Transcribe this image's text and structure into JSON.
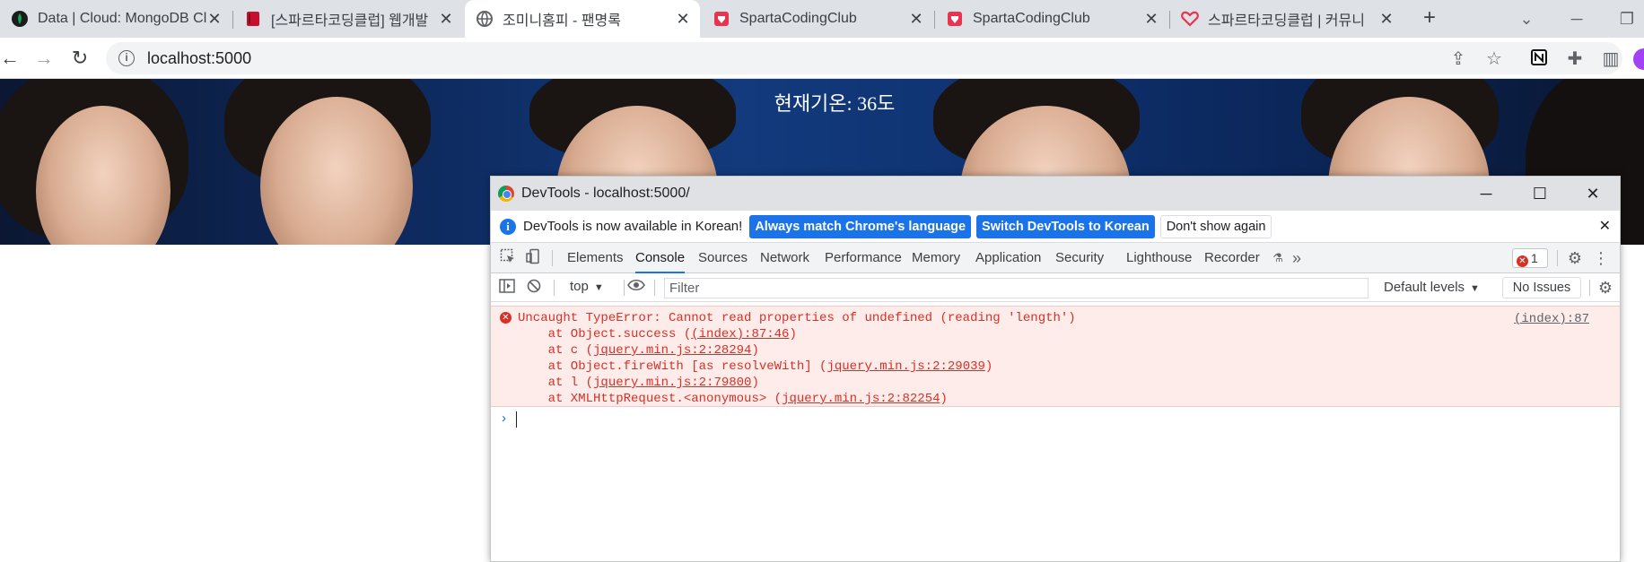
{
  "tabs": [
    {
      "title": "Data | Cloud: MongoDB Cl",
      "icon": "mongodb-leaf-icon"
    },
    {
      "title": "[스파르타코딩클럽] 웹개발",
      "icon": "book-icon"
    },
    {
      "title": "조미니홈피 - 팬명록",
      "icon": "globe-icon",
      "active": true
    },
    {
      "title": "SpartaCodingClub",
      "icon": "sparta-icon"
    },
    {
      "title": "SpartaCodingClub",
      "icon": "sparta-icon"
    },
    {
      "title": "스파르타코딩클럽 | 커뮤니",
      "icon": "heart-icon"
    }
  ],
  "tab_close": "✕",
  "newtab": "+",
  "address": {
    "url": "localhost:5000"
  },
  "page": {
    "weather": "현재기온: 36도"
  },
  "devtools": {
    "title": "DevTools - localhost:5000/",
    "infobar": {
      "message": "DevTools is now available in Korean!",
      "btn_match": "Always match Chrome's language",
      "btn_switch": "Switch DevTools to Korean",
      "btn_dismiss": "Don't show again"
    },
    "tabs": [
      "Elements",
      "Console",
      "Sources",
      "Network",
      "Performance",
      "Memory",
      "Application",
      "Security",
      "Lighthouse",
      "Recorder"
    ],
    "active_tab": "Console",
    "more": "»",
    "error_count": "1",
    "console": {
      "context": "top",
      "filter_placeholder": "Filter",
      "levels": "Default levels",
      "issues": "No Issues"
    },
    "error": {
      "message": "Uncaught TypeError: Cannot read properties of undefined (reading 'length')",
      "source": "(index):87",
      "stack": [
        {
          "pre": "    at Object.success (",
          "link": "(index):87:46",
          "post": ")"
        },
        {
          "pre": "    at c (",
          "link": "jquery.min.js:2:28294",
          "post": ")"
        },
        {
          "pre": "    at Object.fireWith [as resolveWith] (",
          "link": "jquery.min.js:2:29039",
          "post": ")"
        },
        {
          "pre": "    at l (",
          "link": "jquery.min.js:2:79800",
          "post": ")"
        },
        {
          "pre": "    at XMLHttpRequest.<anonymous> (",
          "link": "jquery.min.js:2:82254",
          "post": ")"
        }
      ]
    },
    "prompt": "›"
  }
}
